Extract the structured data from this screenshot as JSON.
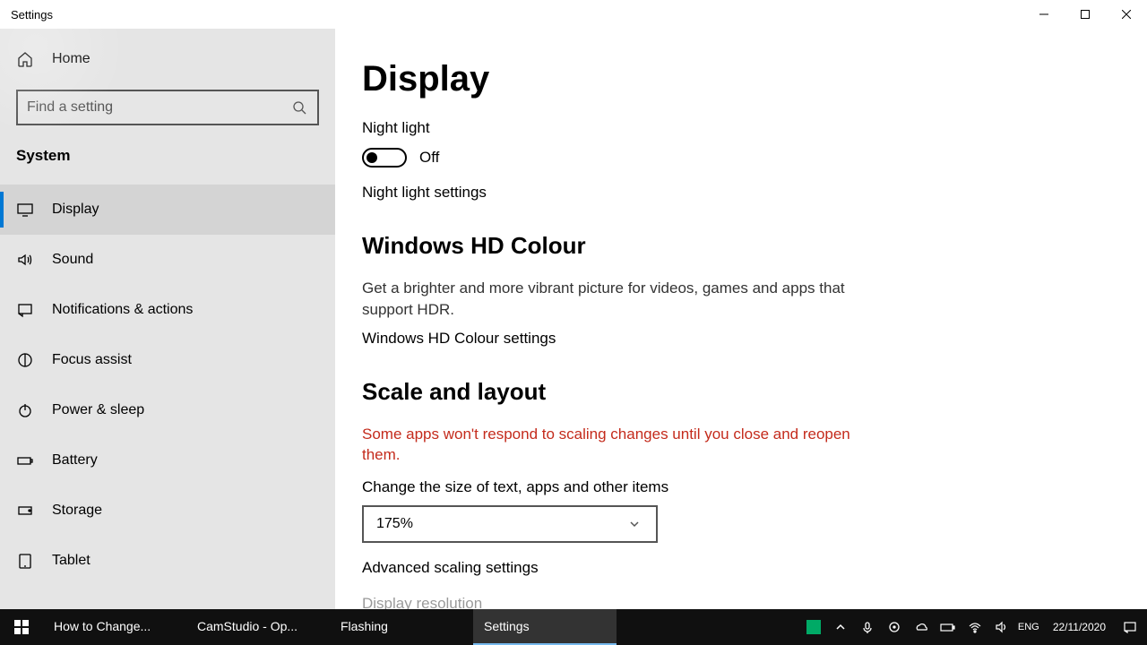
{
  "window": {
    "title": "Settings"
  },
  "sidebar": {
    "home": "Home",
    "search_placeholder": "Find a setting",
    "category": "System",
    "items": [
      {
        "label": "Display",
        "icon": "display-icon",
        "active": true
      },
      {
        "label": "Sound",
        "icon": "sound-icon"
      },
      {
        "label": "Notifications & actions",
        "icon": "notifications-icon"
      },
      {
        "label": "Focus assist",
        "icon": "focus-icon"
      },
      {
        "label": "Power & sleep",
        "icon": "power-icon"
      },
      {
        "label": "Battery",
        "icon": "battery-icon"
      },
      {
        "label": "Storage",
        "icon": "storage-icon"
      },
      {
        "label": "Tablet",
        "icon": "tablet-icon"
      }
    ]
  },
  "main": {
    "title": "Display",
    "night_light_label": "Night light",
    "night_light_state": "Off",
    "night_light_link": "Night light settings",
    "hd_heading": "Windows HD Colour",
    "hd_desc": "Get a brighter and more vibrant picture for videos, games and apps that support HDR.",
    "hd_link": "Windows HD Colour settings",
    "scale_heading": "Scale and layout",
    "scale_warning": "Some apps won't respond to scaling changes until you close and reopen them.",
    "scale_label": "Change the size of text, apps and other items",
    "scale_value": "175%",
    "advanced_link": "Advanced scaling settings",
    "resolution_label": "Display resolution"
  },
  "taskbar": {
    "items": [
      {
        "label": "How to Change..."
      },
      {
        "label": "CamStudio - Op..."
      },
      {
        "label": "Flashing"
      },
      {
        "label": "Settings",
        "active": true
      }
    ],
    "date": "22/11/2020"
  }
}
